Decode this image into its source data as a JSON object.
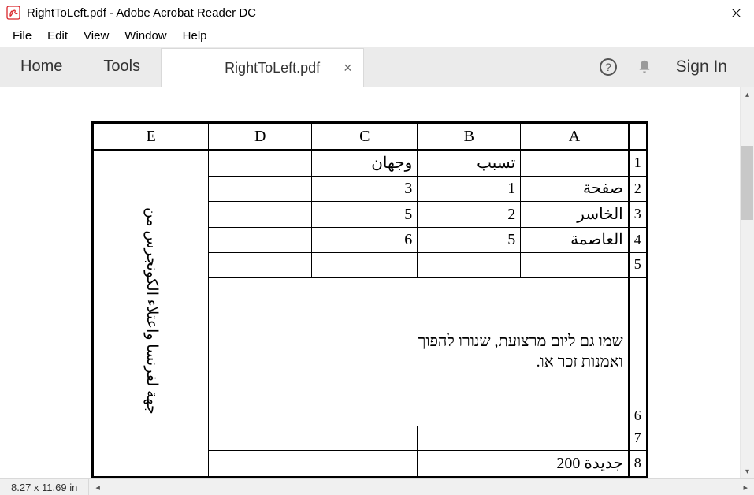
{
  "window": {
    "title": "RightToLeft.pdf - Adobe Acrobat Reader DC"
  },
  "menubar": {
    "file": "File",
    "edit": "Edit",
    "view": "View",
    "window": "Window",
    "help": "Help"
  },
  "toolbar": {
    "home": "Home",
    "tools": "Tools",
    "tab_label": "RightToLeft.pdf",
    "signin": "Sign In"
  },
  "status": {
    "page_size": "8.27 x 11.69 in"
  },
  "table": {
    "headers": {
      "a": "A",
      "b": "B",
      "c": "C",
      "d": "D",
      "e": "E"
    },
    "rownums": {
      "r1": "1",
      "r2": "2",
      "r3": "3",
      "r4": "4",
      "r5": "5",
      "r6": "6",
      "r7": "7",
      "r8": "8"
    },
    "e_vertical": "جهة لفرنسا واعتلاء الكونجرس من",
    "r1": {
      "a": "",
      "b": "تسبب",
      "c": "وجهان",
      "d": ""
    },
    "r2": {
      "a": "صفحة",
      "b": "1",
      "c": "3",
      "d": ""
    },
    "r3": {
      "a": "الخاسر",
      "b": "2",
      "c": "5",
      "d": ""
    },
    "r4": {
      "a": "العاصمة",
      "b": "5",
      "c": "6",
      "d": ""
    },
    "r5": {
      "a": "",
      "b": "",
      "c": "",
      "d": ""
    },
    "r6_merged": "שמו גם ליום מרצועת, שנורו להפוך ואמנות זכר או.",
    "r7": {
      "cd": "",
      "ab": ""
    },
    "r8": {
      "cd": "",
      "ab": "200 جديدة"
    }
  }
}
